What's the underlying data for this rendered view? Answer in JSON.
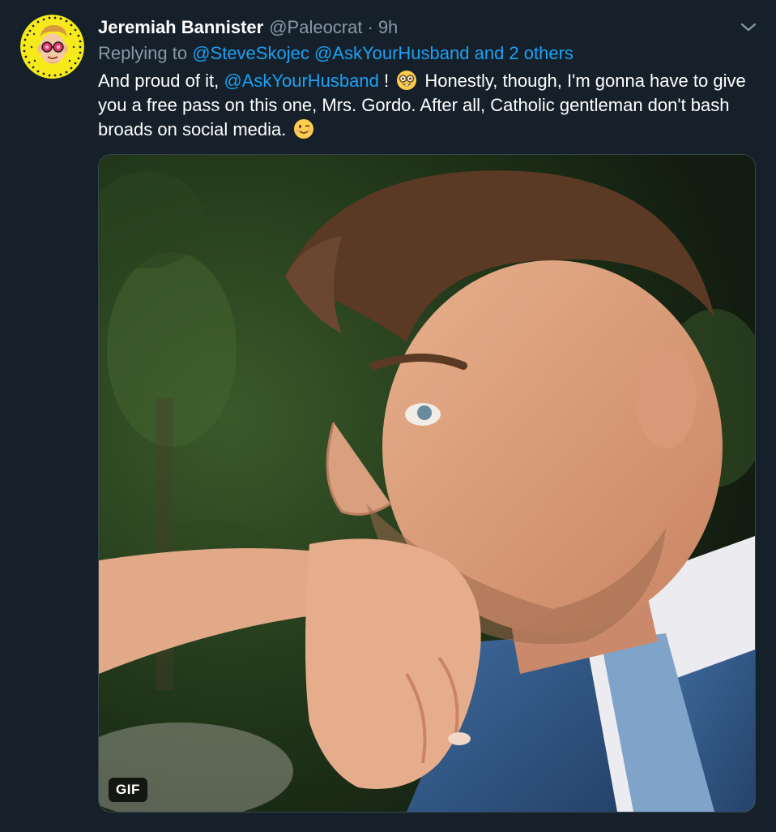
{
  "tweet": {
    "display_name": "Jeremiah Bannister",
    "handle": "@Paleocrat",
    "separator": "·",
    "time": "9h",
    "avatar_icon": "cartoon-face-avatar",
    "menu_icon": "chevron-down-icon"
  },
  "reply": {
    "prefix": "Replying to",
    "mention_1": "@SteveSkojec",
    "mention_2": "@AskYourHusband",
    "others": "and 2 others"
  },
  "body": {
    "part_1": "And proud of it, ",
    "mention": "@AskYourHusband",
    "part_2": " ! ",
    "emoji_1": "nerd-face-emoji",
    "part_3": " Honestly, though, I'm gonna have to give you a free pass on this one, Mrs. Gordo. After all, Catholic gentleman don't bash broads on social media. ",
    "emoji_2": "winking-face-emoji"
  },
  "media": {
    "type": "gif",
    "badge": "GIF",
    "description_icon": "gif-man-kissing-hand"
  },
  "colors": {
    "background": "#15202b",
    "link": "#1da1f2",
    "secondary_text": "#8899a6",
    "border": "#38444d"
  }
}
